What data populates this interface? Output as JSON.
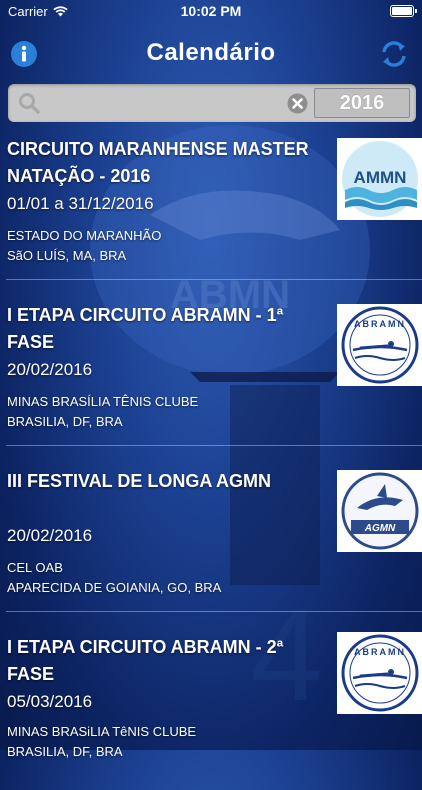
{
  "status_bar": {
    "carrier": "Carrier",
    "time": "10:02 PM"
  },
  "nav": {
    "title": "Calendário"
  },
  "search": {
    "placeholder": "",
    "year": "2016"
  },
  "events": [
    {
      "title_line1": "CIRCUITO MARANHENSE MASTER",
      "title_line2": "NATAÇÃO - 2016",
      "date": "01/01 a 31/12/2016",
      "venue": "ESTADO DO MARANHÃO",
      "city": "SãO LUÍS, MA, BRA",
      "logo_text": "AMMN"
    },
    {
      "title_line1": "I ETAPA CIRCUITO ABRAMN - 1ª FASE",
      "title_line2": "",
      "date": "20/02/2016",
      "venue": "MINAS BRASÍLIA TÊNIS CLUBE",
      "city": "BRASILIA, DF, BRA",
      "logo_text": "ABRAMN"
    },
    {
      "title_line1": "III FESTIVAL DE LONGA AGMN",
      "title_line2": "",
      "date": "20/02/2016",
      "venue": "CEL OAB",
      "city": "APARECIDA DE GOIANIA, GO, BRA",
      "logo_text": "AGMN"
    },
    {
      "title_line1": "I ETAPA CIRCUITO ABRAMN - 2ª FASE",
      "title_line2": "",
      "date": "05/03/2016",
      "venue": "MINAS BRASiLIA TêNIS CLUBE",
      "city": "BRASILIA, DF, BRA",
      "logo_text": "ABRAMN"
    }
  ],
  "background": {
    "watermark_text": "ABMN"
  },
  "colors": {
    "bg_dark": "#0d2463",
    "accent_blue": "#2b7fd6",
    "search_bg": "#c8c8c8"
  }
}
